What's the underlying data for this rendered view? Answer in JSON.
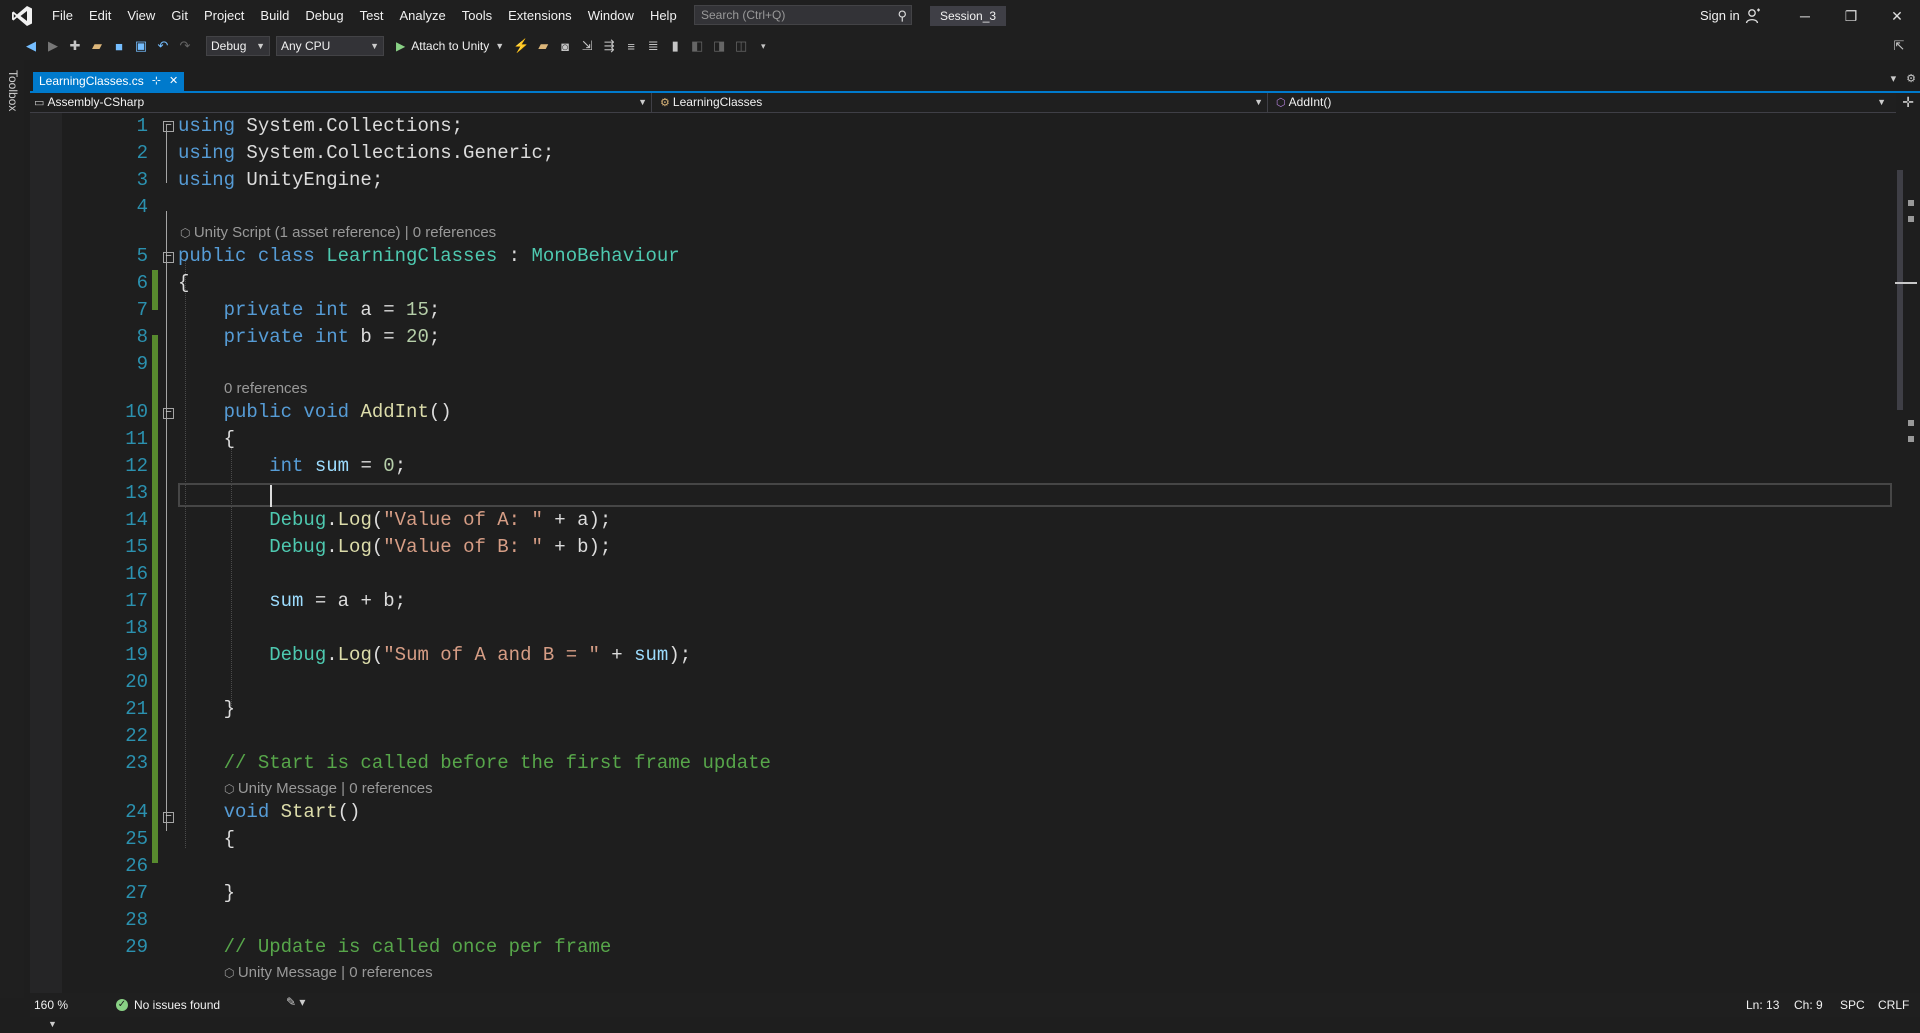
{
  "menu": [
    "File",
    "Edit",
    "View",
    "Git",
    "Project",
    "Build",
    "Debug",
    "Test",
    "Analyze",
    "Tools",
    "Extensions",
    "Window",
    "Help"
  ],
  "search": {
    "placeholder": "Search (Ctrl+Q)"
  },
  "solution_name": "Session_3",
  "account": {
    "sign_in": "Sign in"
  },
  "toolbar": {
    "config": "Debug",
    "platform": "Any CPU",
    "attach": "Attach to Unity"
  },
  "toolbox_label": "Toolbox",
  "tab": {
    "file": "LearningClasses.cs",
    "pin": "⊹",
    "close": "✕"
  },
  "navbar": {
    "project": "Assembly-CSharp",
    "type": "LearningClasses",
    "member": "AddInt()"
  },
  "codelens": {
    "class": "Unity Script (1 asset reference) | 0 references",
    "addint": "0 references",
    "start": "Unity Message | 0 references",
    "update": "Unity Message | 0 references"
  },
  "line_numbers": [
    "1",
    "2",
    "3",
    "4",
    "5",
    "6",
    "7",
    "8",
    "9",
    "10",
    "11",
    "12",
    "13",
    "14",
    "15",
    "16",
    "17",
    "18",
    "19",
    "20",
    "21",
    "22",
    "23",
    "24",
    "25",
    "26",
    "27",
    "28",
    "29"
  ],
  "status": {
    "zoom": "160 %",
    "issues": "No issues found",
    "line": "Ln: 13",
    "col": "Ch: 9",
    "indent": "SPC",
    "eol": "CRLF"
  },
  "colors": {
    "accent": "#007acc",
    "keyword": "#569cd6",
    "type": "#4ec9b0",
    "string": "#d69d85",
    "comment": "#57a64a",
    "change_bar": "#578a2e"
  }
}
